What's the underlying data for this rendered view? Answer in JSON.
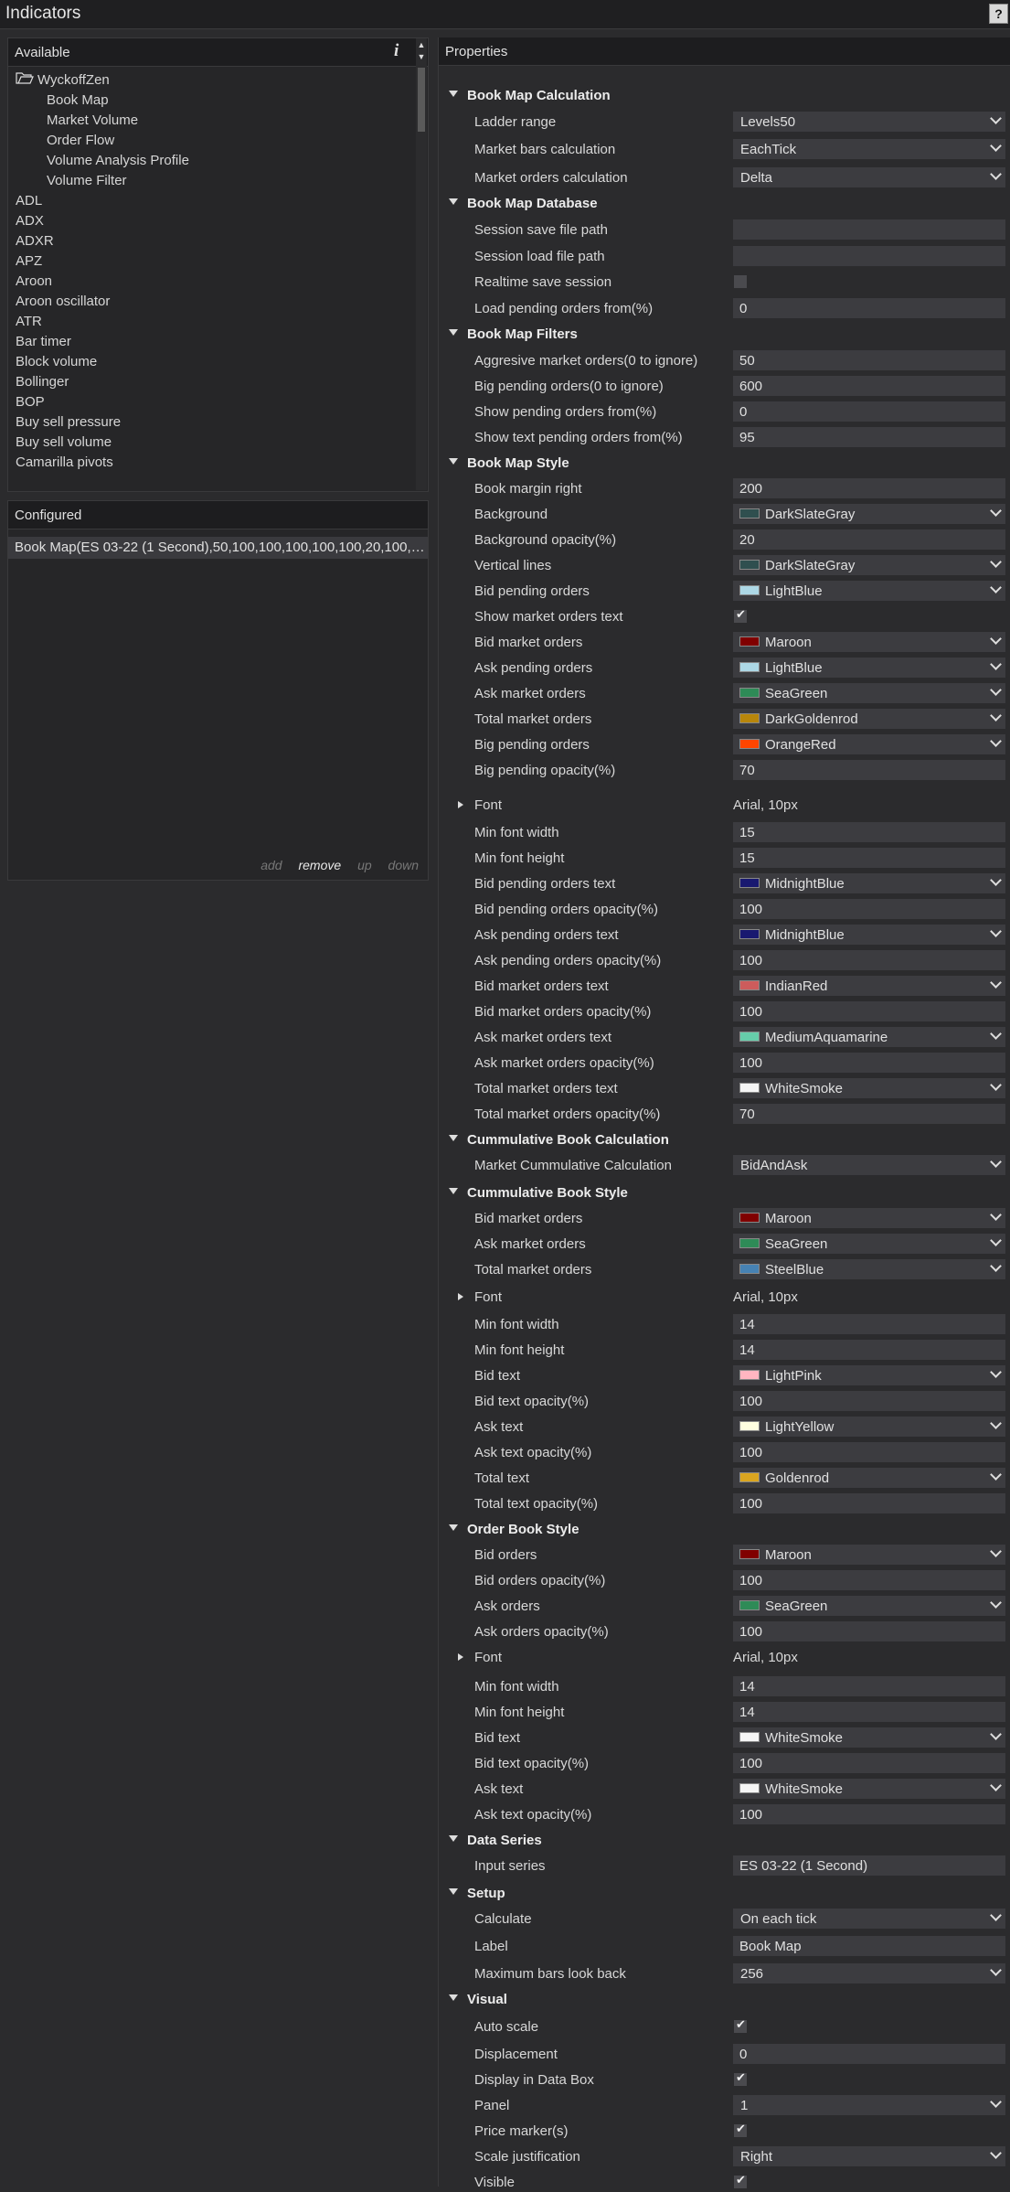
{
  "window": {
    "title": "Indicators",
    "help": "?"
  },
  "available": {
    "title": "Available",
    "info_icon": "i",
    "folder": "WyckoffZen",
    "folder_children": [
      "Book Map",
      "Market Volume",
      "Order Flow",
      "Volume Analysis Profile",
      "Volume Filter"
    ],
    "items": [
      "ADL",
      "ADX",
      "ADXR",
      "APZ",
      "Aroon",
      "Aroon oscillator",
      "ATR",
      "Bar timer",
      "Block volume",
      "Bollinger",
      "BOP",
      "Buy sell pressure",
      "Buy sell volume",
      "Camarilla pivots"
    ]
  },
  "configured": {
    "title": "Configured",
    "item": "Book Map(ES 03-22 (1 Second),50,100,100,100,100,100,20,100,1...",
    "actions": {
      "add": "add",
      "remove": "remove",
      "up": "up",
      "down": "down"
    }
  },
  "properties": {
    "title": "Properties",
    "rows": [
      {
        "t": "cat",
        "label": "Book Map Calculation"
      },
      {
        "t": "sel",
        "label": "Ladder range",
        "value": "Levels50"
      },
      {
        "t": "sel",
        "label": "Market bars calculation",
        "value": "EachTick"
      },
      {
        "t": "sel",
        "label": "Market orders calculation",
        "value": "Delta"
      },
      {
        "t": "cat",
        "label": "Book Map Database"
      },
      {
        "t": "txt",
        "label": "Session save file path",
        "value": ""
      },
      {
        "t": "txt",
        "label": "Session load file path",
        "value": ""
      },
      {
        "t": "chk",
        "label": "Realtime save session",
        "value": false
      },
      {
        "t": "txt",
        "label": "Load pending orders from(%)",
        "value": "0"
      },
      {
        "t": "cat",
        "label": "Book Map Filters"
      },
      {
        "t": "txt",
        "label": "Aggresive market orders(0 to ignore)",
        "value": "50"
      },
      {
        "t": "txt",
        "label": "Big pending orders(0 to ignore)",
        "value": "600"
      },
      {
        "t": "txt",
        "label": "Show pending orders from(%)",
        "value": "0"
      },
      {
        "t": "txt",
        "label": "Show text pending orders from(%)",
        "value": "95"
      },
      {
        "t": "cat",
        "label": "Book Map Style"
      },
      {
        "t": "txt",
        "label": "Book margin right",
        "value": "200"
      },
      {
        "t": "col",
        "label": "Background",
        "value": "DarkSlateGray",
        "color": "#2f4f4f"
      },
      {
        "t": "txt",
        "label": "Background opacity(%)",
        "value": "20"
      },
      {
        "t": "col",
        "label": "Vertical lines",
        "value": "DarkSlateGray",
        "color": "#2f4f4f"
      },
      {
        "t": "col",
        "label": "Bid pending orders",
        "value": "LightBlue",
        "color": "#add8e6"
      },
      {
        "t": "chk",
        "label": "Show market orders text",
        "value": true
      },
      {
        "t": "col",
        "label": "Bid market orders",
        "value": "Maroon",
        "color": "#800000"
      },
      {
        "t": "col",
        "label": "Ask pending orders",
        "value": "LightBlue",
        "color": "#add8e6"
      },
      {
        "t": "col",
        "label": "Ask market orders",
        "value": "SeaGreen",
        "color": "#2e8b57"
      },
      {
        "t": "col",
        "label": "Total market orders",
        "value": "DarkGoldenrod",
        "color": "#b8860b"
      },
      {
        "t": "col",
        "label": "Big pending orders",
        "value": "OrangeRed",
        "color": "#ff4500"
      },
      {
        "t": "txt",
        "label": "Big pending opacity(%)",
        "value": "70"
      },
      {
        "t": "font",
        "label": "Font",
        "value": "Arial, 10px"
      },
      {
        "t": "txt",
        "label": "Min font width",
        "value": "15"
      },
      {
        "t": "txt",
        "label": "Min font height",
        "value": "15"
      },
      {
        "t": "col",
        "label": "Bid pending orders text",
        "value": "MidnightBlue",
        "color": "#191970"
      },
      {
        "t": "txt",
        "label": "Bid pending orders opacity(%)",
        "value": "100"
      },
      {
        "t": "col",
        "label": "Ask pending orders text",
        "value": "MidnightBlue",
        "color": "#191970"
      },
      {
        "t": "txt",
        "label": "Ask pending orders opacity(%)",
        "value": "100"
      },
      {
        "t": "col",
        "label": "Bid market orders text",
        "value": "IndianRed",
        "color": "#cd5c5c"
      },
      {
        "t": "txt",
        "label": "Bid market orders opacity(%)",
        "value": "100"
      },
      {
        "t": "col",
        "label": "Ask market orders text",
        "value": "MediumAquamarine",
        "color": "#66cdaa"
      },
      {
        "t": "txt",
        "label": "Ask market orders opacity(%)",
        "value": "100"
      },
      {
        "t": "col",
        "label": "Total market orders text",
        "value": "WhiteSmoke",
        "color": "#f5f5f5"
      },
      {
        "t": "txt",
        "label": "Total market orders opacity(%)",
        "value": "70"
      },
      {
        "t": "cat",
        "label": "Cummulative Book Calculation"
      },
      {
        "t": "sel",
        "label": "Market Cummulative Calculation",
        "value": "BidAndAsk"
      },
      {
        "t": "cat",
        "label": "Cummulative Book Style"
      },
      {
        "t": "col",
        "label": "Bid market orders",
        "value": "Maroon",
        "color": "#800000"
      },
      {
        "t": "col",
        "label": "Ask market orders",
        "value": "SeaGreen",
        "color": "#2e8b57"
      },
      {
        "t": "col",
        "label": "Total market orders",
        "value": "SteelBlue",
        "color": "#4682b4"
      },
      {
        "t": "font",
        "label": "Font",
        "value": "Arial, 10px"
      },
      {
        "t": "txt",
        "label": "Min font width",
        "value": "14"
      },
      {
        "t": "txt",
        "label": "Min font height",
        "value": "14"
      },
      {
        "t": "col",
        "label": "Bid text",
        "value": "LightPink",
        "color": "#ffb6c1"
      },
      {
        "t": "txt",
        "label": "Bid text opacity(%)",
        "value": "100"
      },
      {
        "t": "col",
        "label": "Ask text",
        "value": "LightYellow",
        "color": "#ffffe0"
      },
      {
        "t": "txt",
        "label": "Ask text opacity(%)",
        "value": "100"
      },
      {
        "t": "col",
        "label": "Total text",
        "value": "Goldenrod",
        "color": "#daa520"
      },
      {
        "t": "txt",
        "label": "Total text opacity(%)",
        "value": "100"
      },
      {
        "t": "cat",
        "label": "Order Book Style"
      },
      {
        "t": "col",
        "label": "Bid orders",
        "value": "Maroon",
        "color": "#800000"
      },
      {
        "t": "txt",
        "label": "Bid orders opacity(%)",
        "value": "100"
      },
      {
        "t": "col",
        "label": "Ask orders",
        "value": "SeaGreen",
        "color": "#2e8b57"
      },
      {
        "t": "txt",
        "label": "Ask orders opacity(%)",
        "value": "100"
      },
      {
        "t": "font",
        "label": "Font",
        "value": "Arial, 10px"
      },
      {
        "t": "txt",
        "label": "Min font width",
        "value": "14"
      },
      {
        "t": "txt",
        "label": "Min font height",
        "value": "14"
      },
      {
        "t": "col",
        "label": "Bid text",
        "value": "WhiteSmoke",
        "color": "#f5f5f5"
      },
      {
        "t": "txt",
        "label": "Bid text opacity(%)",
        "value": "100"
      },
      {
        "t": "col",
        "label": "Ask text",
        "value": "WhiteSmoke",
        "color": "#f5f5f5"
      },
      {
        "t": "txt",
        "label": "Ask text opacity(%)",
        "value": "100"
      },
      {
        "t": "cat",
        "label": "Data Series"
      },
      {
        "t": "txt",
        "label": "Input series",
        "value": "ES 03-22 (1 Second)"
      },
      {
        "t": "cat",
        "label": "Setup"
      },
      {
        "t": "sel",
        "label": "Calculate",
        "value": "On each tick"
      },
      {
        "t": "txt",
        "label": "Label",
        "value": "Book Map"
      },
      {
        "t": "sel",
        "label": "Maximum bars look back",
        "value": "256"
      },
      {
        "t": "cat",
        "label": "Visual"
      },
      {
        "t": "chk",
        "label": "Auto scale",
        "value": true
      },
      {
        "t": "txt",
        "label": "Displacement",
        "value": "0"
      },
      {
        "t": "chk",
        "label": "Display in Data Box",
        "value": true
      },
      {
        "t": "sel",
        "label": "Panel",
        "value": "1"
      },
      {
        "t": "chk",
        "label": "Price marker(s)",
        "value": true
      },
      {
        "t": "sel",
        "label": "Scale justification",
        "value": "Right"
      },
      {
        "t": "chk",
        "label": "Visible",
        "value": true
      }
    ]
  }
}
